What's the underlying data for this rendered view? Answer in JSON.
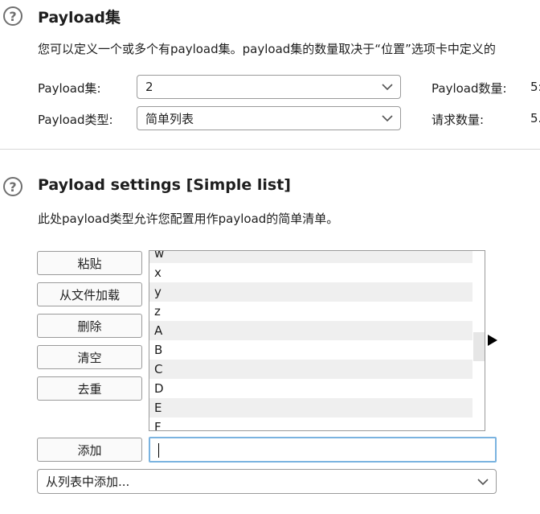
{
  "payload_sets": {
    "title": "Payload集",
    "description": "您可以定义一个或多个有payload集。payload集的数量取决于“位置”选项卡中定义的",
    "set_label": "Payload集:",
    "set_value": "2",
    "type_label": "Payload类型:",
    "type_value": "简单列表",
    "count_label": "Payload数量:",
    "count_value": "5:",
    "request_label": "请求数量:",
    "request_value": "5."
  },
  "payload_settings": {
    "title": "Payload settings [Simple list]",
    "description": "此处payload类型允许您配置用作payload的简单清单。",
    "buttons": {
      "paste": "粘贴",
      "load": "从文件加载",
      "remove": "删除",
      "clear": "清空",
      "dedupe": "去重",
      "add": "添加"
    },
    "list_items": [
      "w",
      "x",
      "y",
      "z",
      "A",
      "B",
      "C",
      "D",
      "E",
      "F"
    ],
    "add_input_value": "",
    "add_from_list": "从列表中添加..."
  }
}
